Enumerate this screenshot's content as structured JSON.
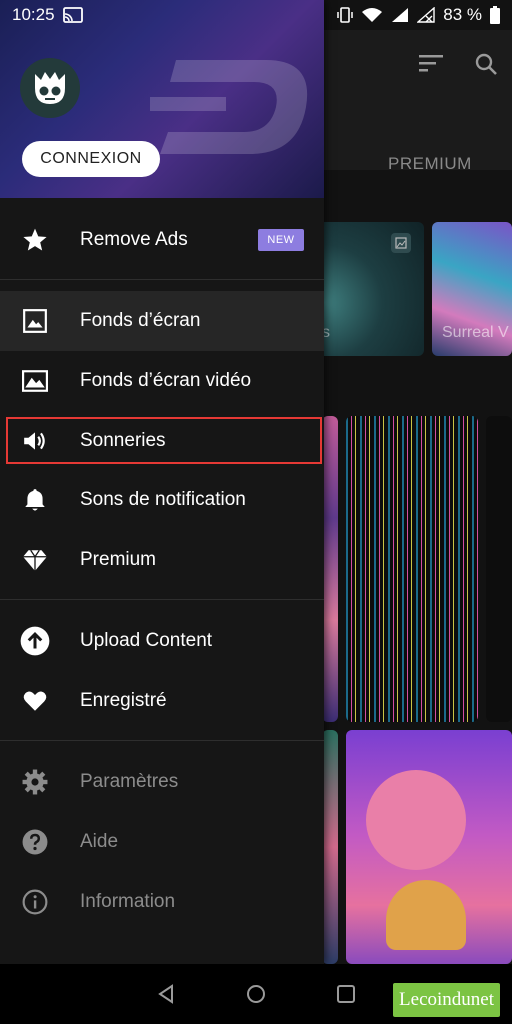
{
  "status_bar": {
    "time": "10:25",
    "battery": "83 %"
  },
  "background_app": {
    "tab_premium": "PREMIUM",
    "thumb_partial_label": "s",
    "thumb_label": "Surreal V"
  },
  "drawer": {
    "login_label": "CONNEXION",
    "items": [
      {
        "label": "Remove Ads",
        "icon": "star-icon",
        "badge": "NEW"
      },
      {
        "label": "Fonds d’écran",
        "icon": "image-icon"
      },
      {
        "label": "Fonds d’écran vidéo",
        "icon": "landscape-icon"
      },
      {
        "label": "Sonneries",
        "icon": "speaker-icon"
      },
      {
        "label": "Sons de notification",
        "icon": "bell-icon"
      },
      {
        "label": "Premium",
        "icon": "diamond-icon"
      },
      {
        "label": "Upload Content",
        "icon": "upload-icon"
      },
      {
        "label": "Enregistré",
        "icon": "heart-icon"
      },
      {
        "label": "Paramètres",
        "icon": "gear-icon"
      },
      {
        "label": "Aide",
        "icon": "help-icon"
      },
      {
        "label": "Information",
        "icon": "info-icon"
      }
    ]
  },
  "watermark": "Lecoindunet",
  "colors": {
    "accent_badge": "#8d7de0",
    "highlight": "#e53935",
    "drawer_bg": "#161616"
  }
}
